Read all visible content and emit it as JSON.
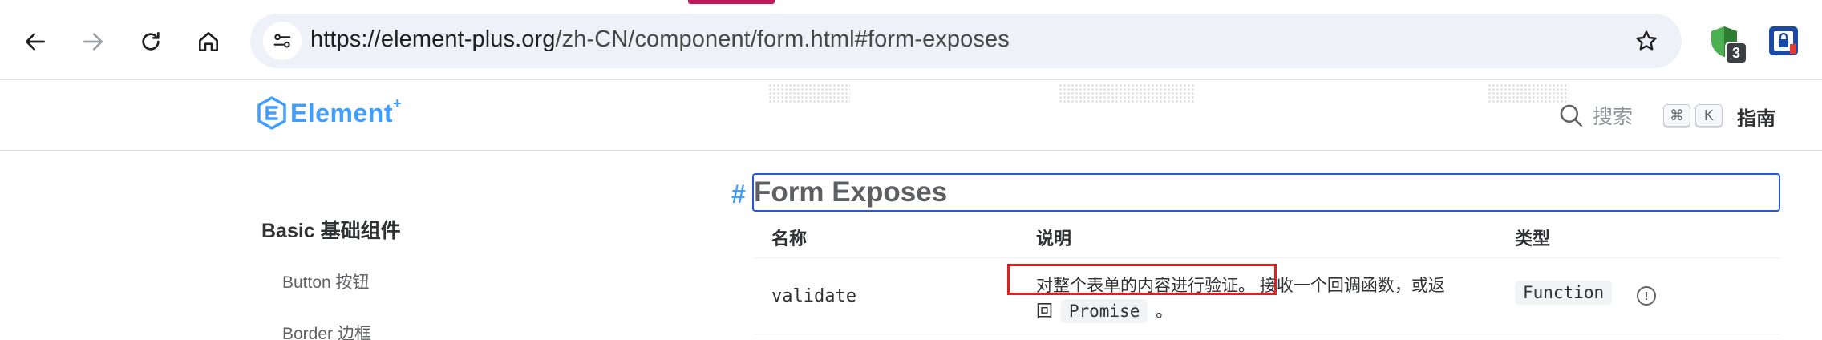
{
  "browser": {
    "url_host": "https://element-plus.org",
    "url_path": "/zh-CN/component/form.html#form-exposes",
    "extension_badge": "3",
    "icons": [
      "back-icon",
      "forward-icon",
      "reload-icon",
      "home-icon",
      "site-info-icon",
      "star-icon",
      "shield-extension-icon",
      "lock-extension-icon"
    ]
  },
  "header": {
    "logo_text": "Element",
    "logo_plus": "+",
    "search_label": "搜索",
    "search_key_1": "⌘",
    "search_key_2": "K",
    "nav_guide": "指南"
  },
  "sidebar": {
    "group_title": "Basic 基础组件",
    "items": [
      {
        "label": "Button 按钮"
      },
      {
        "label": "Border 边框"
      }
    ]
  },
  "main": {
    "anchor": "#",
    "heading": "Form Exposes",
    "columns": [
      "名称",
      "说明",
      "类型"
    ],
    "rows": [
      {
        "name": "validate",
        "desc_part1": "对整个表单的内容进行验证。 接收一个回调函数，或返",
        "desc_part2_prefix": "回",
        "desc_code": "Promise",
        "desc_part2_suffix": "。",
        "type": "Function"
      }
    ]
  },
  "colors": {
    "brand": "#409eff",
    "highlight_box": "#e02020",
    "focus_outline": "#2457d6",
    "tab_indicator": "#c2185b"
  }
}
